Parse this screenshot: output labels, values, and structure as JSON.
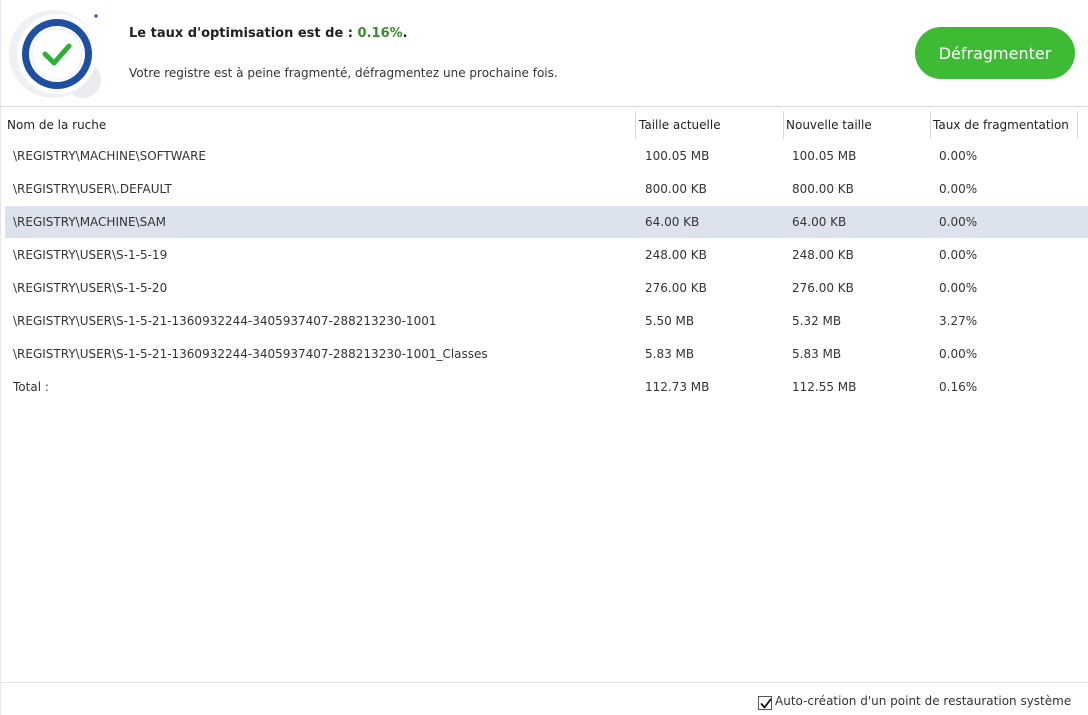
{
  "header": {
    "headline_prefix": "Le taux d'optimisation est de :",
    "optimization_rate": "0.16%",
    "headline_suffix": ".",
    "message": "Votre registre est à peine fragmenté, défragmentez une prochaine fois.",
    "defrag_button_label": "Défragmenter",
    "status_icon": "check-circle-icon"
  },
  "table": {
    "columns": [
      "Nom de la ruche",
      "Taille actuelle",
      "Nouvelle taille",
      "Taux de fragmentation"
    ],
    "rows": [
      {
        "name": "\\REGISTRY\\MACHINE\\SOFTWARE",
        "current": "100.05 MB",
        "new": "100.05 MB",
        "frag": "0.00%"
      },
      {
        "name": "\\REGISTRY\\USER\\.DEFAULT",
        "current": "800.00 KB",
        "new": "800.00 KB",
        "frag": "0.00%"
      },
      {
        "name": "\\REGISTRY\\MACHINE\\SAM",
        "current": "64.00 KB",
        "new": "64.00 KB",
        "frag": "0.00%"
      },
      {
        "name": "\\REGISTRY\\USER\\S-1-5-19",
        "current": "248.00 KB",
        "new": "248.00 KB",
        "frag": "0.00%"
      },
      {
        "name": "\\REGISTRY\\USER\\S-1-5-20",
        "current": "276.00 KB",
        "new": "276.00 KB",
        "frag": "0.00%"
      },
      {
        "name": "\\REGISTRY\\USER\\S-1-5-21-1360932244-3405937407-288213230-1001",
        "current": "5.50 MB",
        "new": "5.32 MB",
        "frag": "3.27%"
      },
      {
        "name": "\\REGISTRY\\USER\\S-1-5-21-1360932244-3405937407-288213230-1001_Classes",
        "current": "5.83 MB",
        "new": "5.83 MB",
        "frag": "0.00%"
      },
      {
        "name": "Total :",
        "current": "112.73 MB",
        "new": "112.55 MB",
        "frag": "0.16%"
      }
    ],
    "selected_row": 2
  },
  "footer": {
    "restore_point_checked": true,
    "restore_point_label": "Auto-création d'un point de restauration système"
  },
  "colors": {
    "accent_green": "#3dbb35",
    "rate_green": "#3c8a2e",
    "selection": "#dde3ee",
    "icon_blue": "#1f4fa0"
  }
}
